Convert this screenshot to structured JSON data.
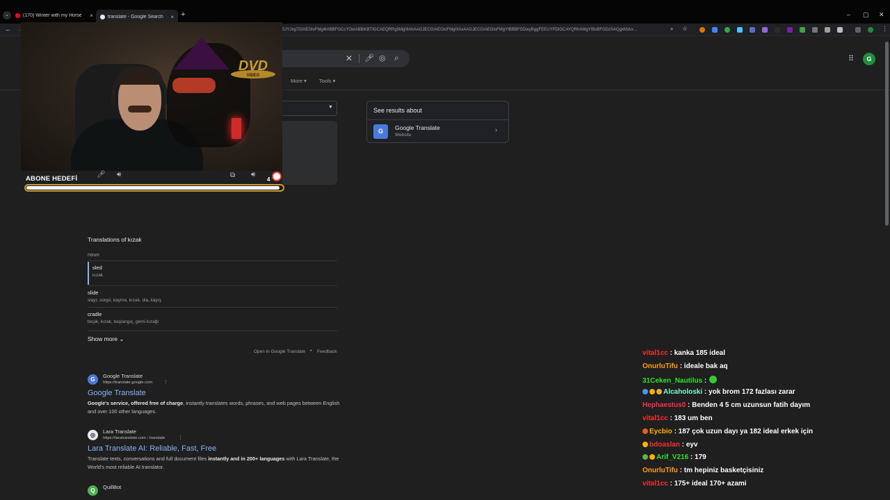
{
  "tabs": [
    {
      "title": "(170) Winter with my Horse - Yo",
      "icon": "youtube-icon",
      "color": "#ff0033"
    },
    {
      "title": "translate - Google Search",
      "icon": "google-icon",
      "color": "#ffffff"
    }
  ],
  "address": {
    "url": "EEUYJxg7GIAEGloFMg4IABBFGCcYOxiABBiKBTIGCAEQRRg5Mg0IAhAAGJECGIAEGloFMg0IAxAAGJECGIAEGloFMgYIBBBFGDwyBggFEEUYPDIGCAYQRhAMgYIBxBFGDzSAQgxMzkx..."
  },
  "search": {
    "more_label": "More",
    "tools_label": "Tools"
  },
  "knowledge_panel": {
    "heading": "See results about",
    "name": "Google Translate",
    "subtitle": "Website",
    "logo_text": "G"
  },
  "overlay": {
    "goal_label": "ABONE HEDEFİ",
    "goal_count": "4",
    "goal_progress": 0.99,
    "dvd_text": "DVD",
    "dvd_sub": "VIDEO"
  },
  "translations": {
    "title": "Translations of kızak",
    "part_of_speech": "noun",
    "rows": [
      {
        "word": "sled",
        "synonyms": "kızak"
      },
      {
        "word": "slide",
        "synonyms": "slayt, sürgü, kayma, kızak, dia, kayış"
      },
      {
        "word": "cradle",
        "synonyms": "beşik, kızak, başlangıç, gemi kızağı"
      }
    ],
    "show_more": "Show more",
    "open_in": "Open in Google Translate",
    "feedback": "Feedback"
  },
  "results": [
    {
      "site": "Google Translate",
      "url": "https://translate.google.com",
      "title": "Google Translate",
      "snippet_bold": "Google's service, offered free of charge",
      "snippet": ", instantly translates words, phrases, and web pages between English and over 100 other languages."
    },
    {
      "site": "Lara Translate",
      "url": "https://laratranslate.com › translate",
      "title": "Lara Translate AI: Reliable, Fast, Free",
      "snippet_pre": "Translate texts, conversations and full document files ",
      "snippet_bold": "instantly and in 200+ languages",
      "snippet": " with Lara Translate, the World's most reliable AI translator."
    },
    {
      "site": "QuillBot"
    }
  ],
  "chat": [
    {
      "user": "vital1cc",
      "color": "#ff2e2e",
      "msg": ": kanka 185 ideal",
      "badges": []
    },
    {
      "user": "OnurluTifu",
      "color": "#ff9f1a",
      "msg": ": ideale bak aq",
      "badges": []
    },
    {
      "user": "31Ceken_Nautilus",
      "color": "#2ee32e",
      "msg": ":",
      "badges": [],
      "emote": "#33cc33"
    },
    {
      "user": "Alcaholoski",
      "color": "#7fffd4",
      "msg": ": yok brom 172 fazlası zarar",
      "badges": [
        "#3a9bff",
        "#ffb000",
        "#e0b040"
      ]
    },
    {
      "user": "Hephaestus0",
      "color": "#ff2e55",
      "msg": ": Benden 4 5 cm uzunsun fatih dayım",
      "badges": []
    },
    {
      "user": "vital1cc",
      "color": "#ff2e2e",
      "msg": ": 183 um ben",
      "badges": []
    },
    {
      "user": "Eycbio",
      "color": "#ffb000",
      "msg": ": 187 çok uzun dayı ya 182 ideal erkek için",
      "badges": [
        "#e06020"
      ]
    },
    {
      "user": "bdoaslan",
      "color": "#ff2e2e",
      "msg": ": eyv",
      "badges": [
        "#ffb000"
      ]
    },
    {
      "user": "Arif_V216",
      "color": "#2ee32e",
      "msg": ": 179",
      "badges": [
        "#5fb04a",
        "#ffb000"
      ]
    },
    {
      "user": "OnurluTifu",
      "color": "#ff9f1a",
      "msg": ": tm hepiniz basketçisiniz",
      "badges": []
    },
    {
      "user": "vital1cc",
      "color": "#ff2e2e",
      "msg": ": 175+ ideal 170+ azami",
      "badges": []
    }
  ],
  "account": {
    "avatar_letter": "G",
    "avatar_color": "#1e8e3e"
  }
}
